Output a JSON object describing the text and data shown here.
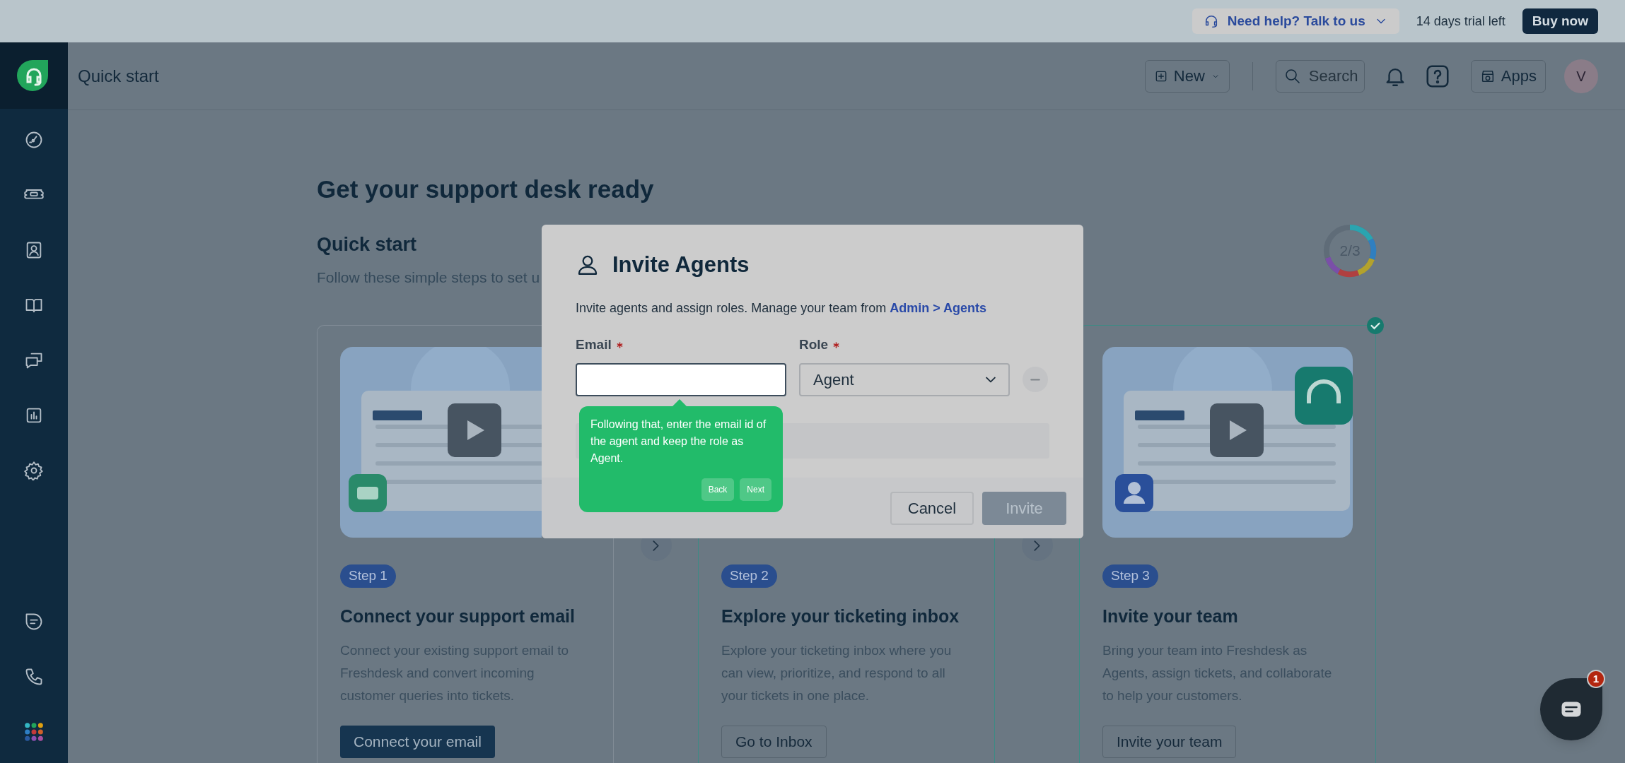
{
  "top_bar": {
    "help": "Need help? Talk to us",
    "trial": "14 days trial left",
    "buy": "Buy now"
  },
  "header": {
    "title": "Quick start",
    "new_button": "New",
    "search": {
      "placeholder": "Search"
    },
    "apps": "Apps",
    "avatar": "V"
  },
  "page": {
    "heading": "Get your support desk ready",
    "section_title": "Quick start",
    "subtitle": "Follow these simple steps to set u",
    "progress": "2/3"
  },
  "steps": [
    {
      "badge": "Step 1",
      "title": "Connect your support email",
      "description": "Connect your existing support email to Freshdesk and convert incoming customer queries into tickets.",
      "button": "Connect your email",
      "primary": true,
      "completed": false
    },
    {
      "badge": "Step 2",
      "title": "Explore your ticketing inbox",
      "description": "Explore your ticketing inbox where you can view, prioritize, and respond to all your tickets in one place.",
      "button": "Go to Inbox",
      "primary": false,
      "completed": true,
      "check_mark": false
    },
    {
      "badge": "Step 3",
      "title": "Invite your team",
      "description": "Bring your team into Freshdesk as Agents, assign tickets, and collaborate to help your customers.",
      "button": "Invite your team",
      "primary": false,
      "completed": true,
      "check_mark": true
    }
  ],
  "modal": {
    "title": "Invite Agents",
    "description": "Invite agents and assign roles. Manage your team from ",
    "link": "Admin > Agents",
    "email_label": "Email",
    "role_label": "Role",
    "role_value": "Agent",
    "cancel": "Cancel",
    "invite": "Invite",
    "invite_disabled": true
  },
  "tour_tip": {
    "text": "Following that, enter the email id of the agent and keep the role as Agent.",
    "back": "Back",
    "next": "Next"
  },
  "chat": {
    "badge": "1"
  }
}
